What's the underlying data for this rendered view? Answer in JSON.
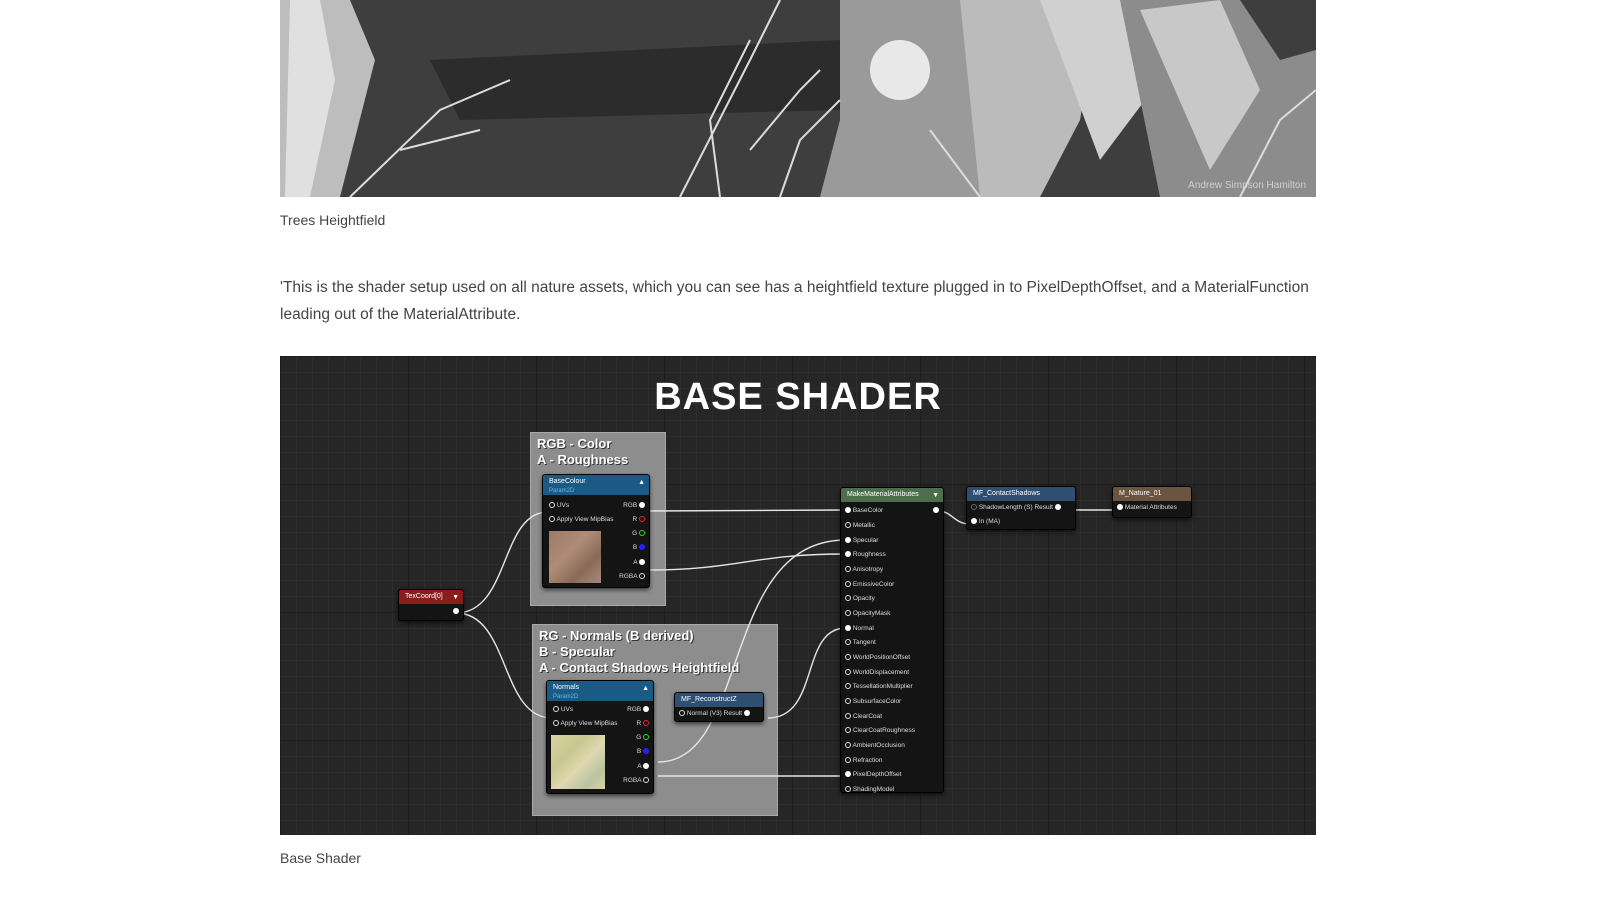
{
  "hero": {
    "credit": "Andrew Simpson Hamilton"
  },
  "captions": {
    "trees": "Trees Heightfield",
    "base": "Base Shader"
  },
  "paragraph": "'This is the shader setup used on all nature assets, which you can see has a heightfield texture plugged in to PixelDepthOffset, and a MaterialFunction leading out of the MaterialAttribute.",
  "graph": {
    "title": "BASE SHADER",
    "comment1": "RGB - Color\nA - Roughness",
    "comment2": "RG - Normals (B derived)\nB - Specular\nA - Contact Shadows Heightfield",
    "texcoord": "TexCoord[0]",
    "basecolour": {
      "title": "BaseColour",
      "sub": "Param2D",
      "uvs": "UVs",
      "mip": "Apply View MipBias",
      "outs": [
        "RGB",
        "R",
        "G",
        "B",
        "A",
        "RGBA"
      ]
    },
    "normals": {
      "title": "Normals",
      "sub": "Param2D",
      "uvs": "UVs",
      "mip": "Apply View MipBias",
      "outs": [
        "RGB",
        "R",
        "G",
        "B",
        "A",
        "RGBA"
      ]
    },
    "reconstruct": {
      "title": "MF_ReconstructZ",
      "pin": "Normal (V3) Result"
    },
    "make": {
      "title": "MakeMaterialAttributes",
      "pins": [
        "BaseColor",
        "Metallic",
        "Specular",
        "Roughness",
        "Anisotropy",
        "EmissiveColor",
        "Opacity",
        "OpacityMask",
        "Normal",
        "Tangent",
        "WorldPositionOffset",
        "WorldDisplacement",
        "TessellationMultiplier",
        "SubsurfaceColor",
        "ClearCoat",
        "ClearCoatRoughness",
        "AmbientOcclusion",
        "Refraction",
        "PixelDepthOffset",
        "ShadingModel"
      ]
    },
    "contact": {
      "title": "MF_ContactShadows",
      "pin1": "ShadowLength (S) Result",
      "pin2": "In (MA)"
    },
    "nature": {
      "title": "M_Nature_01",
      "pin": "Material Attributes"
    }
  },
  "colors": {
    "texcoord_head": "#8a1c1c",
    "param_head": "#1c5a86",
    "make_head": "#4c6e4c",
    "func_head": "#2e4f72",
    "nature_head": "#6b5440"
  }
}
